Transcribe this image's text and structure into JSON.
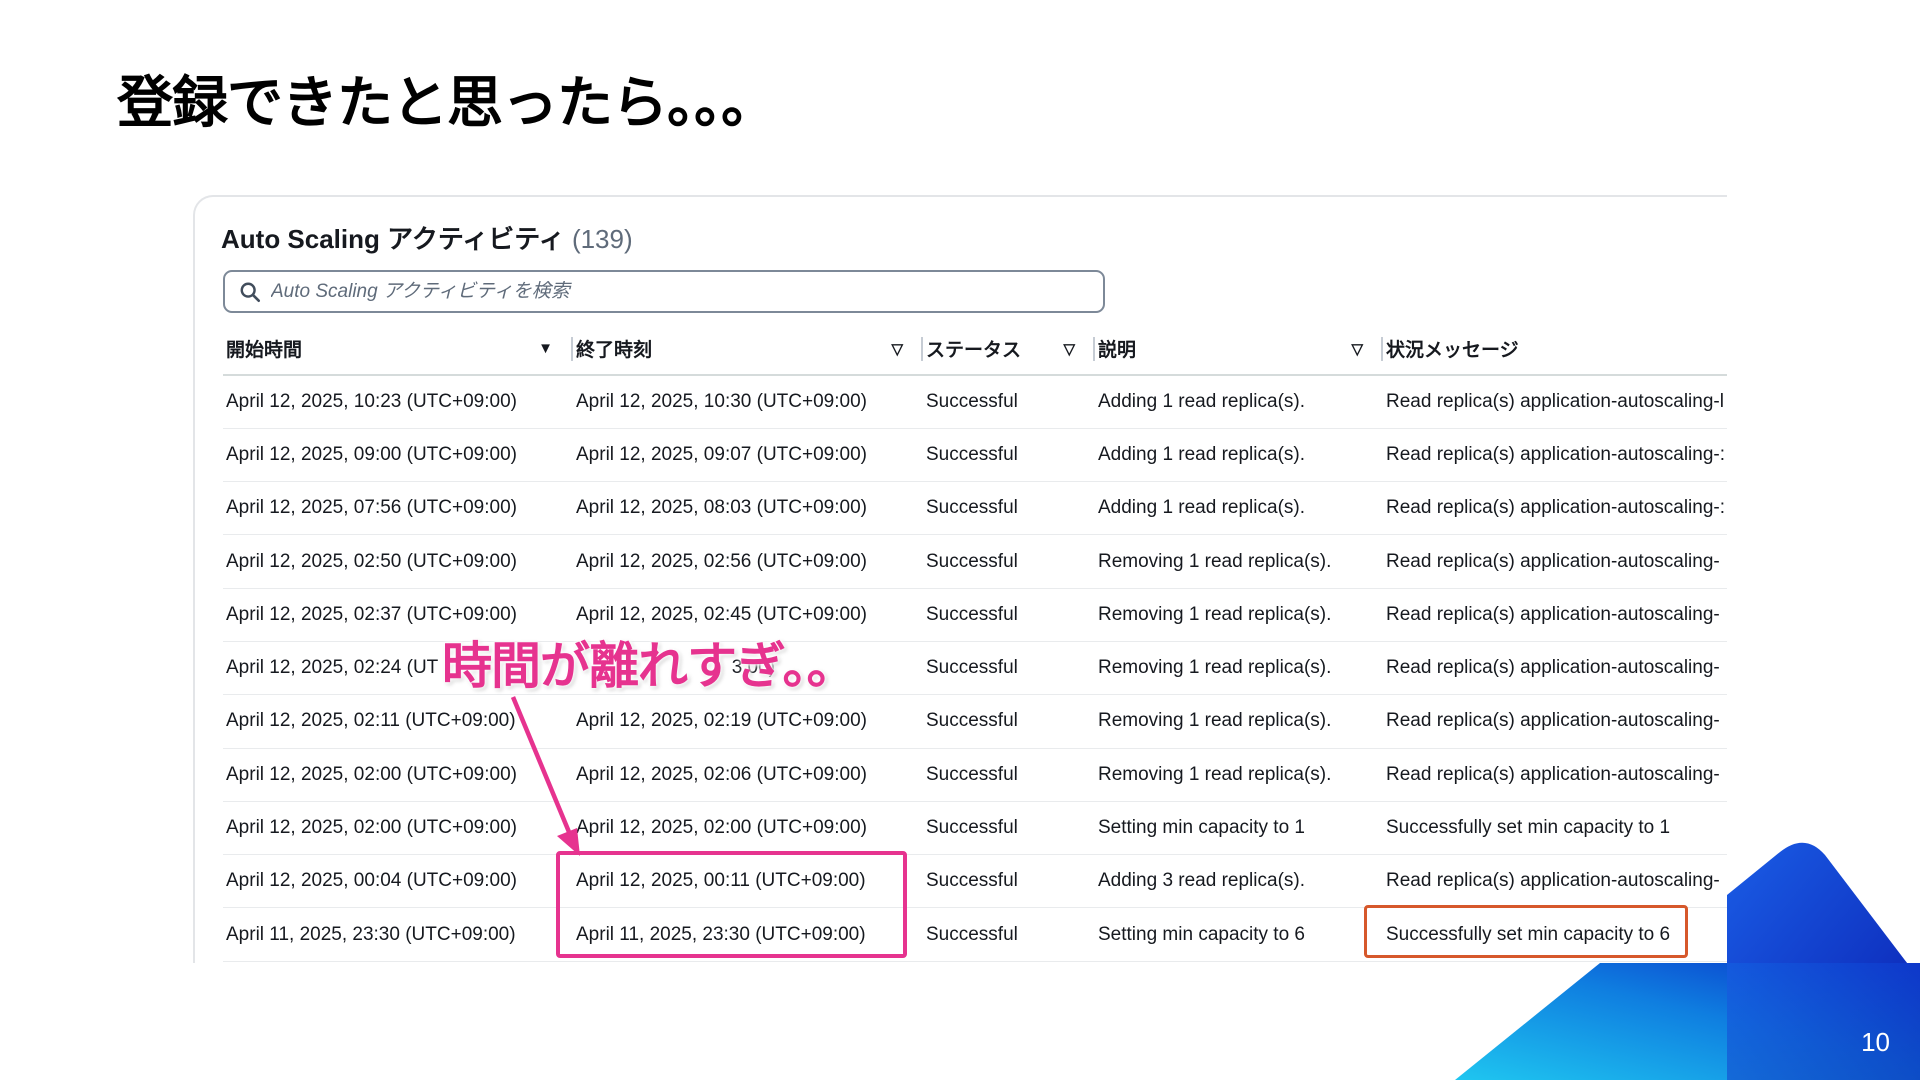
{
  "slide": {
    "title": "登録できたと思ったら。。。",
    "page_number": "10",
    "callout": "時間が離れすぎ。。"
  },
  "panel": {
    "title": "Auto Scaling アクティビティ",
    "count": "(139)",
    "search_placeholder": "Auto Scaling アクティビティを検索",
    "columns": [
      {
        "label": "開始時間",
        "sort": "▼"
      },
      {
        "label": "終了時刻",
        "sort": "▽"
      },
      {
        "label": "ステータス",
        "sort": "▽"
      },
      {
        "label": "説明",
        "sort": "▽"
      },
      {
        "label": "状況メッセージ",
        "sort": ""
      }
    ],
    "rows": [
      {
        "start": "April 12, 2025, 10:23 (UTC+09:00)",
        "end": "April 12, 2025, 10:30 (UTC+09:00)",
        "status": "Successful",
        "description": "Adding 1 read replica(s).",
        "message": "Read replica(s) application-autoscaling-l"
      },
      {
        "start": "April 12, 2025, 09:00 (UTC+09:00)",
        "end": "April 12, 2025, 09:07 (UTC+09:00)",
        "status": "Successful",
        "description": "Adding 1 read replica(s).",
        "message": "Read replica(s) application-autoscaling-:"
      },
      {
        "start": "April 12, 2025, 07:56 (UTC+09:00)",
        "end": "April 12, 2025, 08:03 (UTC+09:00)",
        "status": "Successful",
        "description": "Adding 1 read replica(s).",
        "message": "Read replica(s) application-autoscaling-:"
      },
      {
        "start": "April 12, 2025, 02:50 (UTC+09:00)",
        "end": "April 12, 2025, 02:56 (UTC+09:00)",
        "status": "Successful",
        "description": "Removing 1 read replica(s).",
        "message": "Read replica(s) application-autoscaling-"
      },
      {
        "start": "April 12, 2025, 02:37 (UTC+09:00)",
        "end": "April 12, 2025, 02:45 (UTC+09:00)",
        "status": "Successful",
        "description": "Removing 1 read replica(s).",
        "message": "Read replica(s) application-autoscaling-"
      },
      {
        "start": "April 12, 2025, 02:24 (UT",
        "end": "3 00)",
        "status": "Successful",
        "description": "Removing 1 read replica(s).",
        "message": "Read replica(s) application-autoscaling-"
      },
      {
        "start": "April 12, 2025, 02:11 (UTC+09:00)",
        "end": "April 12, 2025, 02:19 (UTC+09:00)",
        "status": "Successful",
        "description": "Removing 1 read replica(s).",
        "message": "Read replica(s) application-autoscaling-"
      },
      {
        "start": "April 12, 2025, 02:00 (UTC+09:00)",
        "end": "April 12, 2025, 02:06 (UTC+09:00)",
        "status": "Successful",
        "description": "Removing 1 read replica(s).",
        "message": "Read replica(s) application-autoscaling-"
      },
      {
        "start": "April 12, 2025, 02:00 (UTC+09:00)",
        "end": "April 12, 2025, 02:00 (UTC+09:00)",
        "status": "Successful",
        "description": "Setting min capacity to 1",
        "message": "Successfully set min capacity to 1"
      },
      {
        "start": "April 12, 2025, 00:04 (UTC+09:00)",
        "end": "April 12, 2025, 00:11 (UTC+09:00)",
        "status": "Successful",
        "description": "Adding 3 read replica(s).",
        "message": "Read replica(s) application-autoscaling-"
      },
      {
        "start": "April 11, 2025, 23:30 (UTC+09:00)",
        "end": "April 11, 2025, 23:30 (UTC+09:00)",
        "status": "Successful",
        "description": "Setting min capacity to 6",
        "message": "Successfully set min capacity to 6"
      }
    ]
  },
  "colors": {
    "highlight_pink": "#e6338f",
    "highlight_orange": "#d6582b",
    "accent_blue": "#0a2fd0",
    "accent_cyan": "#19b6ee"
  },
  "icons": {
    "search": "search-icon",
    "callout_arrow": "arrow-icon"
  }
}
